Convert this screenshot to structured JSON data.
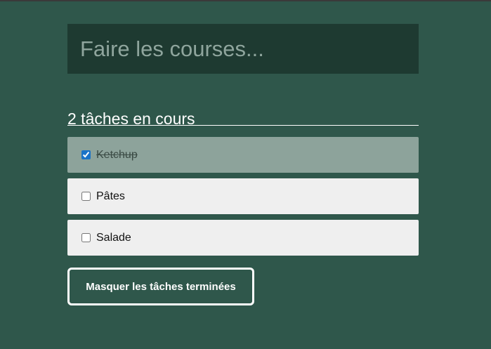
{
  "new_task": {
    "placeholder": "Faire les courses..."
  },
  "counter": {
    "label": "2 tâches en cours"
  },
  "tasks": [
    {
      "label": "Ketchup",
      "done": true
    },
    {
      "label": "Pâtes",
      "done": false
    },
    {
      "label": "Salade",
      "done": false
    }
  ],
  "actions": {
    "hide_completed_label": "Masquer les tâches terminées"
  },
  "colors": {
    "background": "#2f574b",
    "input_background": "#1e3a31",
    "task_background": "#efefef",
    "task_done_background": "#8da39b",
    "text_light": "#ffffff"
  }
}
